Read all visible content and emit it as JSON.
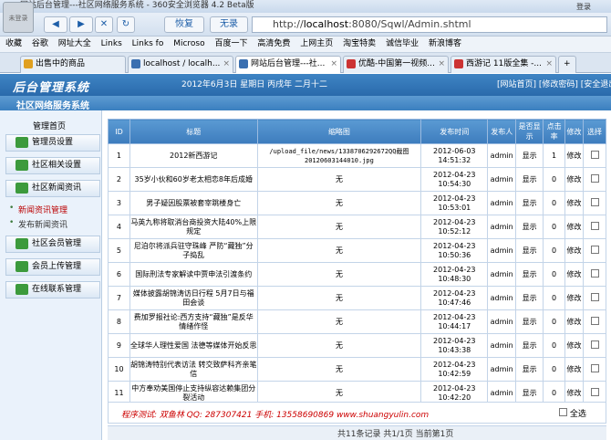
{
  "browser": {
    "title": "网站后台管理---社区网络服务系统 - 360安全浏览器 4.2 Beta版",
    "avatar_text": "未登录",
    "login": "登录",
    "back": "◀",
    "forward": "▶",
    "stop": "✕",
    "refresh": "↻",
    "restore": "恢复",
    "dropdown": "无录",
    "address_prefix": "http://",
    "address_host": "localhost",
    "address_rest": ":8080/Sqwl/Admin.shtml",
    "bookmarks": [
      "收藏",
      "谷歌",
      "网址大全",
      "Links",
      "Links fo",
      "Microso",
      "百度一下",
      "高清免费",
      "上网主页",
      "淘宝特卖",
      "诚信毕业",
      "新浪博客"
    ],
    "tabs": [
      {
        "label": "出售中的商品",
        "color": "#e0a020"
      },
      {
        "label": "localhost / localh...",
        "color": "#3a6fb0"
      },
      {
        "label": "网站后台管理---社...",
        "color": "#3a6fb0",
        "active": true
      },
      {
        "label": "优酷-中国第一视频...",
        "color": "#c33"
      },
      {
        "label": "西游记 11版全集 -...",
        "color": "#c33"
      }
    ],
    "new_tab": "+"
  },
  "site": {
    "logo": "后台管理系统",
    "system_name": "社区网络服务系统",
    "date": "2012年6月3日 星期日 丙戌年 二月十二",
    "links": "[网站首页] [修改密码] [安全退出]"
  },
  "sidebar": {
    "home": "管理首页",
    "items": [
      "管理员设置",
      "社区相关设置",
      "社区新闻资讯"
    ],
    "subs": [
      "新闻资讯管理",
      "发布新闻资讯"
    ],
    "items2": [
      "社区会员管理",
      "会员上传管理",
      "在线联系管理"
    ]
  },
  "table": {
    "headers": [
      "ID",
      "标题",
      "缩略图",
      "发布时间",
      "发布人",
      "是否显示",
      "点击率",
      "修改",
      "选择"
    ],
    "rows": [
      {
        "id": "1",
        "title": "2012新西游记",
        "thumb": "/upload_file/news/1338706292672QQ截图20120603144010.jpg",
        "time": "2012-06-03 14:51:32",
        "author": "admin",
        "show": "显示",
        "clicks": "1",
        "edit": "修改"
      },
      {
        "id": "2",
        "title": "35岁小伙和60岁老太相恋8年后成婚",
        "thumb": "无",
        "time": "2012-04-23 10:54:30",
        "author": "admin",
        "show": "显示",
        "clicks": "0",
        "edit": "修改"
      },
      {
        "id": "3",
        "title": "男子疑因股票被套宰跳楼身亡",
        "thumb": "无",
        "time": "2012-04-23 10:53:01",
        "author": "admin",
        "show": "显示",
        "clicks": "0",
        "edit": "修改"
      },
      {
        "id": "4",
        "title": "马英九称将取消台商投资大陆40%上限规定",
        "thumb": "无",
        "time": "2012-04-23 10:52:12",
        "author": "admin",
        "show": "显示",
        "clicks": "0",
        "edit": "修改"
      },
      {
        "id": "5",
        "title": "尼泊尔将派兵驻守珠峰 严防“藏独”分子捣乱",
        "thumb": "无",
        "time": "2012-04-23 10:50:36",
        "author": "admin",
        "show": "显示",
        "clicks": "0",
        "edit": "修改"
      },
      {
        "id": "6",
        "title": "国际刑法专家解读中贾申法引渡条约",
        "thumb": "无",
        "time": "2012-04-23 10:48:30",
        "author": "admin",
        "show": "显示",
        "clicks": "0",
        "edit": "修改"
      },
      {
        "id": "7",
        "title": "媒体披露胡锦涛访日行程 5月7日与福田会谈",
        "thumb": "无",
        "time": "2012-04-23 10:47:46",
        "author": "admin",
        "show": "显示",
        "clicks": "0",
        "edit": "修改"
      },
      {
        "id": "8",
        "title": "费加罗报社论:西方支持“藏独”是反华情绪作怪",
        "thumb": "无",
        "time": "2012-04-23 10:44:17",
        "author": "admin",
        "show": "显示",
        "clicks": "0",
        "edit": "修改"
      },
      {
        "id": "9",
        "title": "全球华人理性爱国 法德等媒体开始反思",
        "thumb": "无",
        "time": "2012-04-23 10:43:38",
        "author": "admin",
        "show": "显示",
        "clicks": "0",
        "edit": "修改"
      },
      {
        "id": "10",
        "title": "胡锦涛特别代表访法 转交致萨科齐亲笔信",
        "thumb": "无",
        "time": "2012-04-23 10:42:59",
        "author": "admin",
        "show": "显示",
        "clicks": "0",
        "edit": "修改"
      },
      {
        "id": "11",
        "title": "中方奉劝美国停止支持纵容达赖集团分裂活动",
        "thumb": "无",
        "time": "2012-04-23 10:42:20",
        "author": "admin",
        "show": "显示",
        "clicks": "0",
        "edit": "修改"
      }
    ]
  },
  "footer": {
    "credit": "程序测试: 双鱼林 QQ: 287307421 手机: 13558690869 www.shuangyulin.com",
    "select_all": "全选",
    "pager": "共11条记录 共1/1页 当前第1页"
  }
}
